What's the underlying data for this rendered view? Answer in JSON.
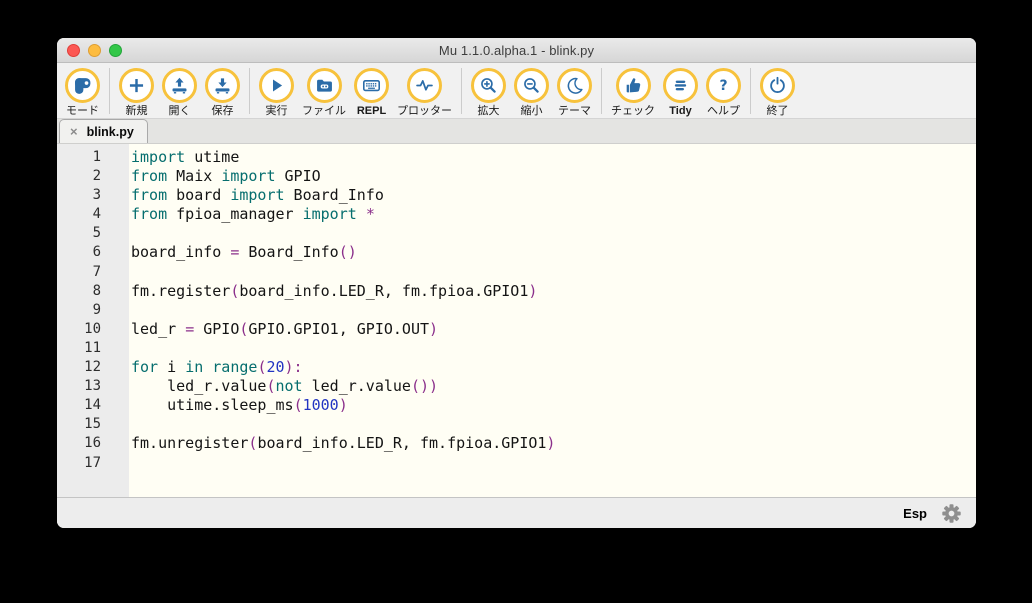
{
  "window": {
    "title": "Mu 1.1.0.alpha.1 - blink.py"
  },
  "traffic_lights": {
    "close": "red",
    "minimize": "yellow",
    "zoom": "green"
  },
  "toolbar": {
    "groups": [
      [
        {
          "icon": "mode-icon",
          "label": "モード"
        }
      ],
      [
        {
          "icon": "new-icon",
          "label": "新規"
        },
        {
          "icon": "open-icon",
          "label": "開く"
        },
        {
          "icon": "save-icon",
          "label": "保存"
        }
      ],
      [
        {
          "icon": "run-icon",
          "label": "実行"
        },
        {
          "icon": "files-icon",
          "label": "ファイル"
        },
        {
          "icon": "repl-icon",
          "label": "REPL"
        },
        {
          "icon": "plotter-icon",
          "label": "プロッター"
        }
      ],
      [
        {
          "icon": "zoom-in-icon",
          "label": "拡大"
        },
        {
          "icon": "zoom-out-icon",
          "label": "縮小"
        },
        {
          "icon": "theme-icon",
          "label": "テーマ"
        }
      ],
      [
        {
          "icon": "check-icon",
          "label": "チェック"
        },
        {
          "icon": "tidy-icon",
          "label": "Tidy"
        },
        {
          "icon": "help-icon",
          "label": "ヘルプ"
        }
      ],
      [
        {
          "icon": "quit-icon",
          "label": "終了"
        }
      ]
    ]
  },
  "tabs": [
    {
      "label": "blink.py",
      "close": "×",
      "active": true
    }
  ],
  "editor": {
    "lines": [
      {
        "n": "1",
        "tokens": [
          [
            "k",
            "import"
          ],
          [
            "p",
            " utime"
          ]
        ]
      },
      {
        "n": "2",
        "tokens": [
          [
            "k",
            "from"
          ],
          [
            "p",
            " Maix "
          ],
          [
            "k",
            "import"
          ],
          [
            "p",
            " GPIO"
          ]
        ]
      },
      {
        "n": "3",
        "tokens": [
          [
            "k",
            "from"
          ],
          [
            "p",
            " board "
          ],
          [
            "k",
            "import"
          ],
          [
            "p",
            " Board_Info"
          ]
        ]
      },
      {
        "n": "4",
        "tokens": [
          [
            "k",
            "from"
          ],
          [
            "p",
            " fpioa_manager "
          ],
          [
            "k",
            "import"
          ],
          [
            "p",
            " "
          ],
          [
            "o",
            "*"
          ]
        ]
      },
      {
        "n": "5",
        "tokens": []
      },
      {
        "n": "6",
        "tokens": [
          [
            "p",
            "board_info "
          ],
          [
            "o",
            "="
          ],
          [
            "p",
            " Board_Info"
          ],
          [
            "o",
            "()"
          ]
        ]
      },
      {
        "n": "7",
        "tokens": []
      },
      {
        "n": "8",
        "tokens": [
          [
            "p",
            "fm.register"
          ],
          [
            "o",
            "("
          ],
          [
            "p",
            "board_info.LED_R, fm.fpioa.GPIO1"
          ],
          [
            "o",
            ")"
          ]
        ]
      },
      {
        "n": "9",
        "tokens": []
      },
      {
        "n": "10",
        "tokens": [
          [
            "p",
            "led_r "
          ],
          [
            "o",
            "="
          ],
          [
            "p",
            " GPIO"
          ],
          [
            "o",
            "("
          ],
          [
            "p",
            "GPIO.GPIO1, GPIO.OUT"
          ],
          [
            "o",
            ")"
          ]
        ]
      },
      {
        "n": "11",
        "tokens": []
      },
      {
        "n": "12",
        "tokens": [
          [
            "k",
            "for"
          ],
          [
            "p",
            " i "
          ],
          [
            "k",
            "in"
          ],
          [
            "p",
            " "
          ],
          [
            "k",
            "range"
          ],
          [
            "o",
            "("
          ],
          [
            "n",
            "20"
          ],
          [
            "o",
            "):"
          ]
        ]
      },
      {
        "n": "13",
        "tokens": [
          [
            "p",
            "    led_r.value"
          ],
          [
            "o",
            "("
          ],
          [
            "k",
            "not"
          ],
          [
            "p",
            " led_r.value"
          ],
          [
            "o",
            "())"
          ]
        ]
      },
      {
        "n": "14",
        "tokens": [
          [
            "p",
            "    utime.sleep_ms"
          ],
          [
            "o",
            "("
          ],
          [
            "n",
            "1000"
          ],
          [
            "o",
            ")"
          ]
        ]
      },
      {
        "n": "15",
        "tokens": []
      },
      {
        "n": "16",
        "tokens": [
          [
            "p",
            "fm.unregister"
          ],
          [
            "o",
            "("
          ],
          [
            "p",
            "board_info.LED_R, fm.fpioa.GPIO1"
          ],
          [
            "o",
            ")"
          ]
        ]
      },
      {
        "n": "17",
        "tokens": []
      }
    ]
  },
  "statusbar": {
    "mode_label": "Esp",
    "gear": "settings-gear-icon"
  },
  "colors": {
    "keyword": "#066e6e",
    "number": "#2234c2",
    "operator": "#8b2f8b",
    "plain": "#141414",
    "icon_ring": "#f7c23c",
    "icon_glyph": "#2b6ca8",
    "editor_bg": "#fffef4",
    "gutter_bg": "#ececec"
  }
}
